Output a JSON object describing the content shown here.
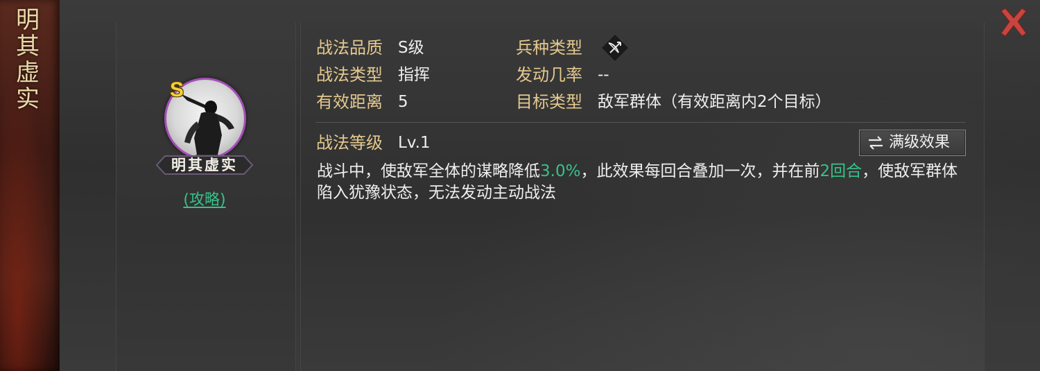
{
  "banner": {
    "title": "明其虚实"
  },
  "skill": {
    "grade": "S",
    "name": "明其虚实",
    "guide_link": "(攻略)"
  },
  "info": {
    "quality_label": "战法品质",
    "quality_value": "S级",
    "type_label": "战法类型",
    "type_value": "指挥",
    "range_label": "有效距离",
    "range_value": "5",
    "troop_label": "兵种类型",
    "troop_icon": "bow-icon",
    "rate_label": "发动几率",
    "rate_value": "--",
    "target_label": "目标类型",
    "target_value": "敌军群体（有效距离内2个目标）"
  },
  "level": {
    "label": "战法等级",
    "value": "Lv.1",
    "max_button": "满级效果"
  },
  "description": {
    "part1": "战斗中，使敌军全体的谋略降低",
    "hl1": "3.0%",
    "part2": "，此效果每回合叠加一次，并在前",
    "hl2": "2回合",
    "part3": "，使敌军群体陷入犹豫状态，无法发动主动战法"
  },
  "colors": {
    "label": "#e4c98e",
    "highlight": "#37c28a",
    "grade_ring": "#a34fb5",
    "close": "#c8453f"
  }
}
